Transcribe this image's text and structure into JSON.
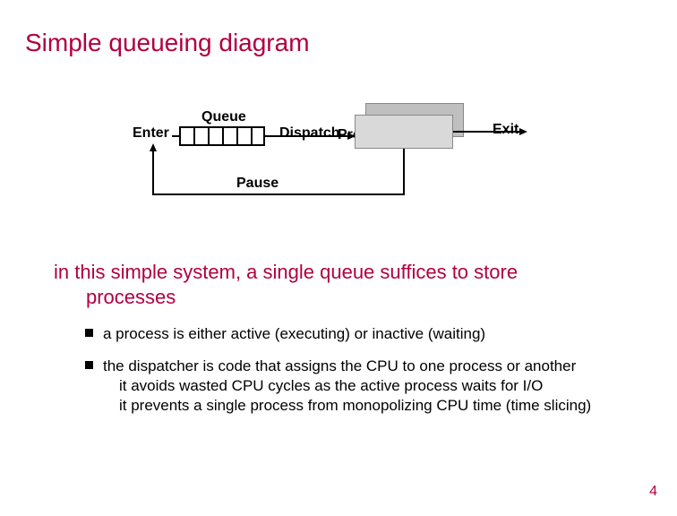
{
  "title": "Simple queueing diagram",
  "diagram": {
    "enter": "Enter",
    "queue": "Queue",
    "dispatch": "Dispatch",
    "processor": "Processor",
    "exit": "Exit",
    "pause": "Pause"
  },
  "body": {
    "line1a": "in this simple system, a single queue suffices to store",
    "line1b": "processes",
    "bullet1": "a process is either active (executing) or inactive (waiting)",
    "bullet2_main": "the dispatcher is code that assigns the CPU to one process or another",
    "bullet2_sub1": "it avoids wasted CPU cycles as the active process waits for I/O",
    "bullet2_sub2": "it prevents a single process from monopolizing  CPU time (time slicing)"
  },
  "page_number": "4"
}
